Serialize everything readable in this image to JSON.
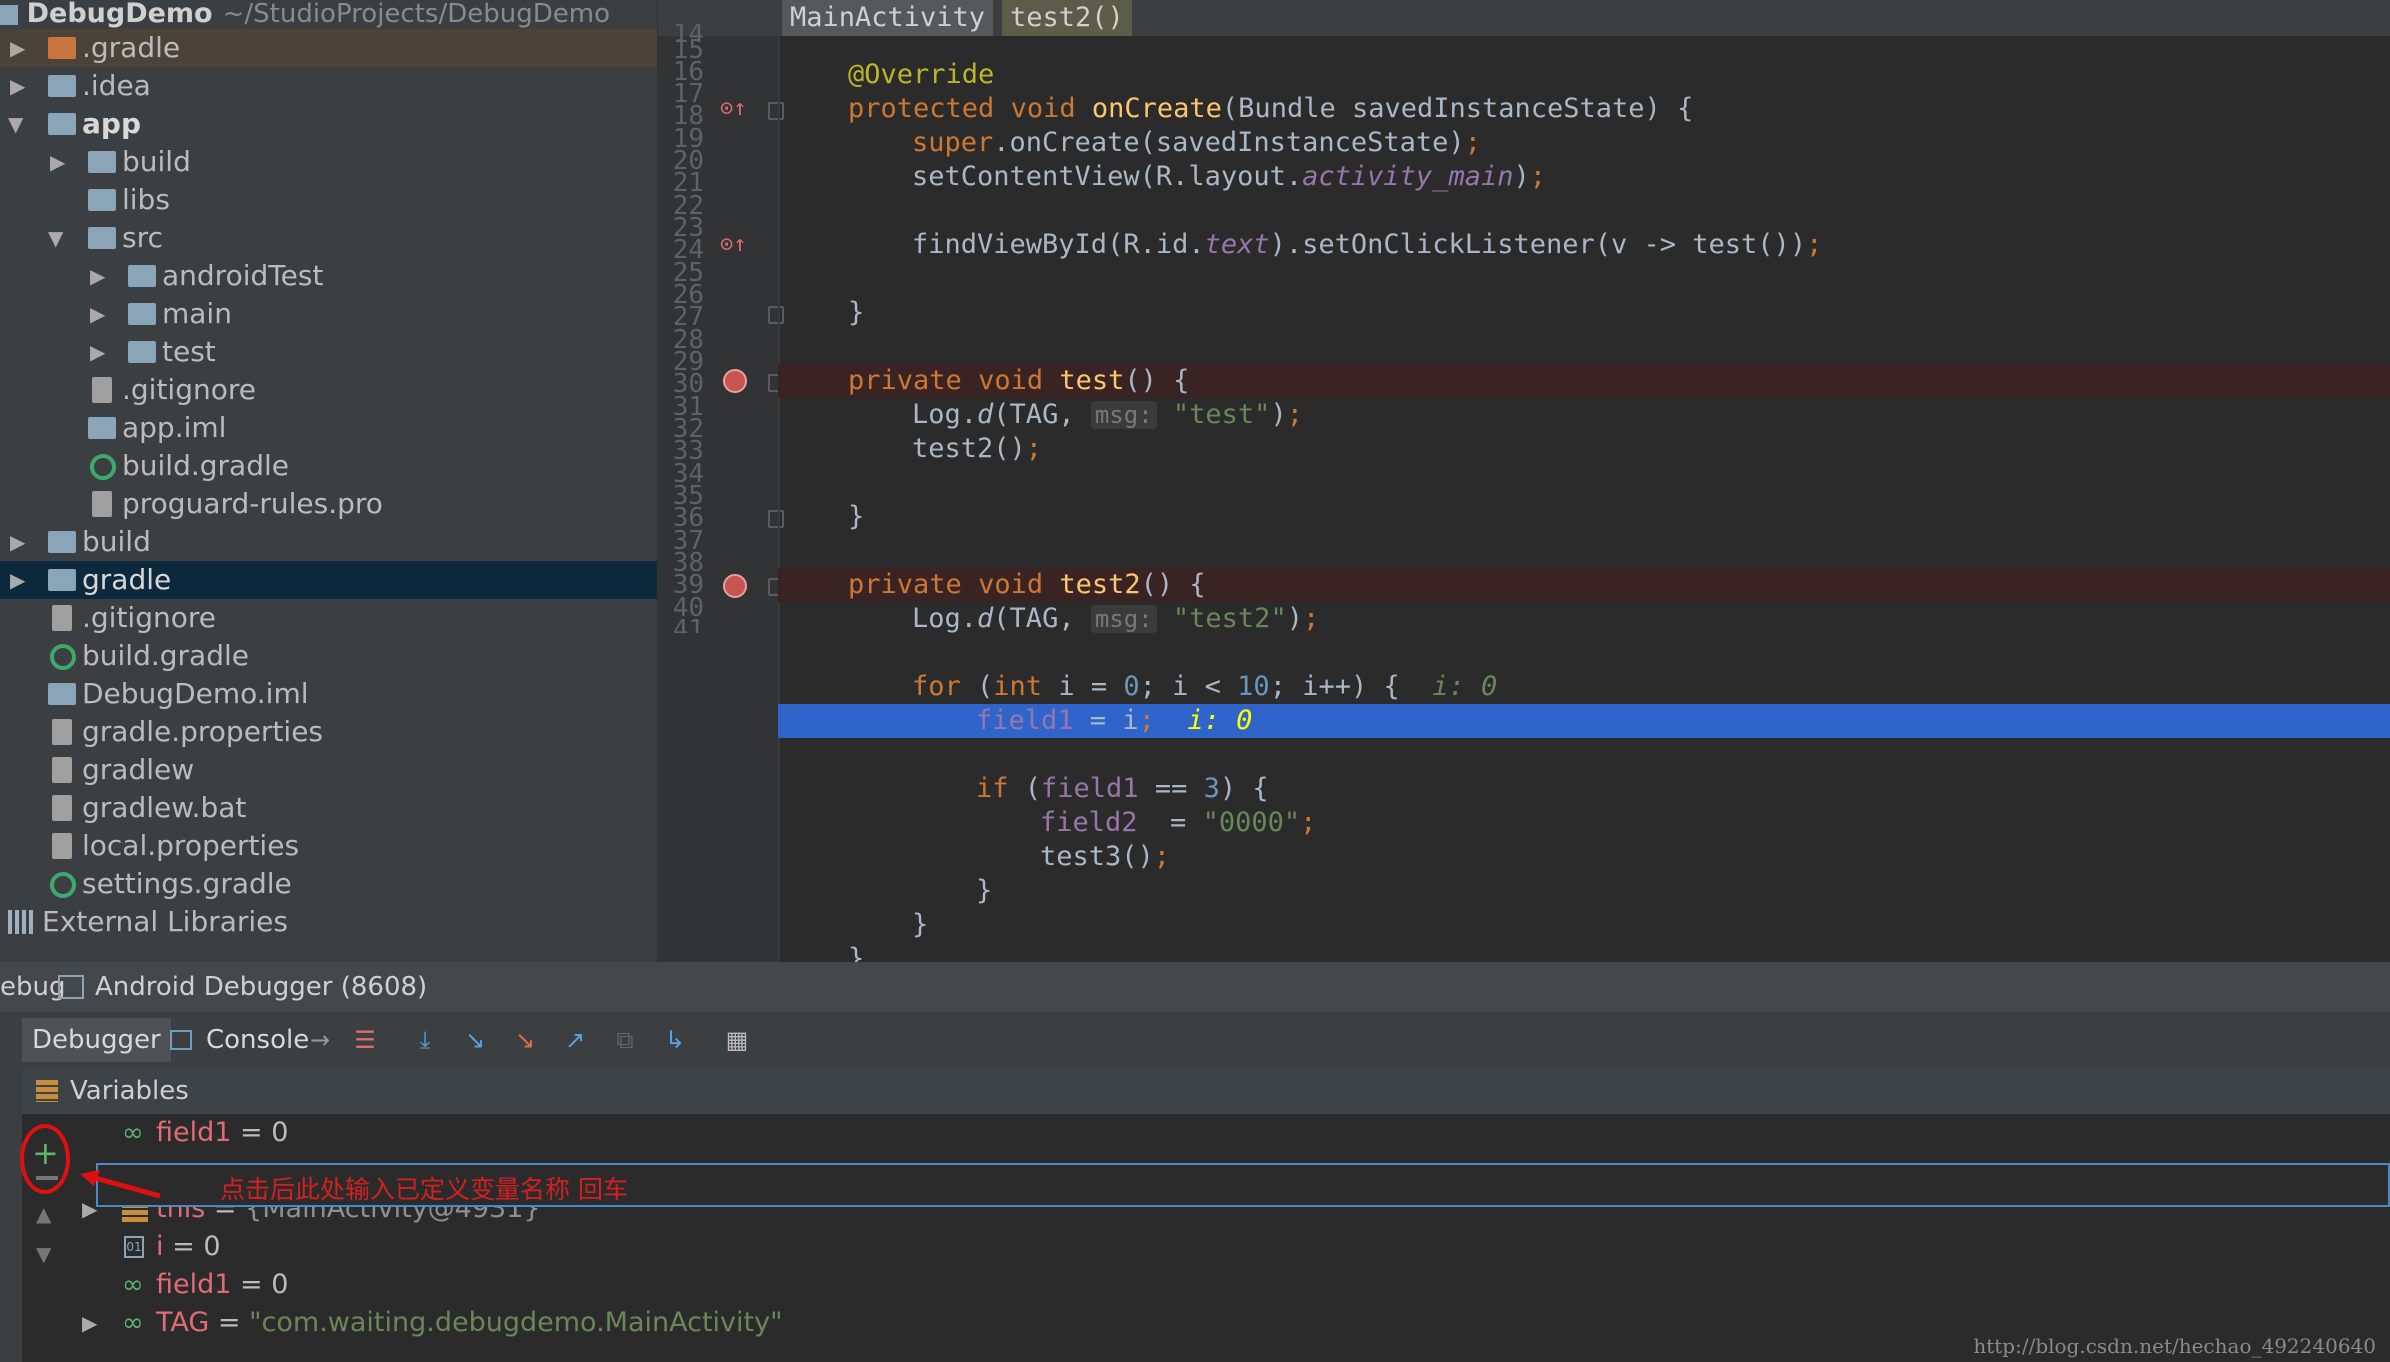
{
  "project": {
    "name": "DebugDemo",
    "path": "~/StudioProjects/DebugDemo",
    "items": [
      {
        "label": ".gradle"
      },
      {
        "label": ".idea"
      },
      {
        "label": "app"
      },
      {
        "label": "build"
      },
      {
        "label": "libs"
      },
      {
        "label": "src"
      },
      {
        "label": "androidTest"
      },
      {
        "label": "main"
      },
      {
        "label": "test"
      },
      {
        "label": ".gitignore"
      },
      {
        "label": "app.iml"
      },
      {
        "label": "build.gradle"
      },
      {
        "label": "proguard-rules.pro"
      },
      {
        "label": "build"
      },
      {
        "label": "gradle"
      },
      {
        "label": ".gitignore"
      },
      {
        "label": "build.gradle"
      },
      {
        "label": "DebugDemo.iml"
      },
      {
        "label": "gradle.properties"
      },
      {
        "label": "gradlew"
      },
      {
        "label": "gradlew.bat"
      },
      {
        "label": "local.properties"
      },
      {
        "label": "settings.gradle"
      },
      {
        "label": "External Libraries"
      }
    ]
  },
  "editor": {
    "breadcrumbs": [
      "MainActivity",
      "test2()"
    ],
    "line_numbers": [
      "14",
      "15",
      "16",
      "17",
      "18",
      "19",
      "20",
      "21",
      "22",
      "23",
      "24",
      "25",
      "26",
      "27",
      "28",
      "29",
      "30",
      "31",
      "32",
      "33",
      "34",
      "35",
      "36",
      "37",
      "38",
      "39",
      "40",
      "41"
    ],
    "tokens": {
      "override": "@Override",
      "protected": "protected",
      "void": "void",
      "private": "private",
      "onCreate": "onCreate",
      "onCreate_params": "(Bundle savedInstanceState) {",
      "super": "super",
      "super_call": ".onCreate(savedInstanceState)",
      "semi": ";",
      "setContent_a": "setContentView(R.layout.",
      "activity_main": "activity_main",
      "paren_close": ")",
      "find_a": "findViewById(R.id.",
      "text": "text",
      "find_b": ").setOnClickListener(v -> test())",
      "brace_close": "}",
      "test_fn": "test",
      "test2_fn": "test2",
      "sig_tail": "() {",
      "log_a": "Log.",
      "log_d": "d",
      "log_tag": "(TAG, ",
      "msg_hint": "msg:",
      "str_test": "\"test\"",
      "str_test2": "\"test2\"",
      "log_close": ")",
      "test2_call": "test2()",
      "for_kw": "for",
      "for_open": " (",
      "int_kw": "int",
      "for_a": " i = ",
      "zero": "0",
      "for_b": "; i < ",
      "ten": "10",
      "for_c": "; i++) {  ",
      "inline_i": "i: 0",
      "field1": "field1",
      "assign_i": " = i",
      "if_kw": "if",
      "if_open": " (",
      "if_mid": " == ",
      "three": "3",
      "if_close": ") {",
      "field2": "field2",
      "assign": "  = ",
      "str_0000": "\"0000\"",
      "test3_call": "test3()"
    }
  },
  "debug": {
    "title_prefix": "ebug",
    "session": "Android Debugger (8608)",
    "tabs": [
      "Debugger",
      "Console"
    ],
    "variables_header": "Variables",
    "rows": [
      {
        "name": "field1",
        "eq": " = ",
        "value": "0"
      },
      {
        "name": "this",
        "eq": " = ",
        "value": "{MainActivity@4931}"
      },
      {
        "name": "i",
        "eq": " = ",
        "value": "0"
      },
      {
        "name": "field1",
        "eq": " = ",
        "value": "0"
      },
      {
        "name": "TAG",
        "eq": " = ",
        "value": "\"com.waiting.debugdemo.MainActivity\""
      }
    ],
    "annotation": "点击后此处输入已定义变量名称 回车"
  },
  "watermark": "http://blog.csdn.net/hechao_492240640",
  "colors": {
    "accent_blue": "#2f65ca",
    "breakpoint_red": "#c75450",
    "annotation_red": "#e01010"
  }
}
